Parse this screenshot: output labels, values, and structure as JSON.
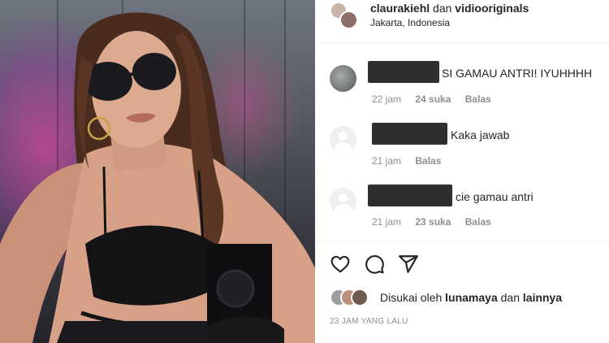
{
  "post": {
    "photo_alt": "",
    "header": {
      "username_1": "claurakiehl",
      "conjunction": "dan",
      "username_2": "vidiooriginals",
      "location": "Jakarta, Indonesia"
    },
    "comments": [
      {
        "text": "SI GAMAU ANTRI! IYUHHHH",
        "time": "22 jam",
        "likes": "24 suka",
        "reply": "Balas",
        "avatar": "photo"
      },
      {
        "text": "Kaka jawab",
        "time": "21 jam",
        "likes": "",
        "reply": "Balas",
        "avatar": "default"
      },
      {
        "text": "cie gamau antri",
        "time": "21 jam",
        "likes": "23 suka",
        "reply": "Balas",
        "avatar": "default"
      }
    ],
    "actions": {
      "like_icon": "heart-icon",
      "comment_icon": "comment-icon",
      "share_icon": "send-icon"
    },
    "liked_by": {
      "prefix": "Disukai oleh",
      "user": "lunamaya",
      "conjunction": "dan",
      "others": "lainnya"
    },
    "timestamp": "23 JAM YANG LALU"
  }
}
